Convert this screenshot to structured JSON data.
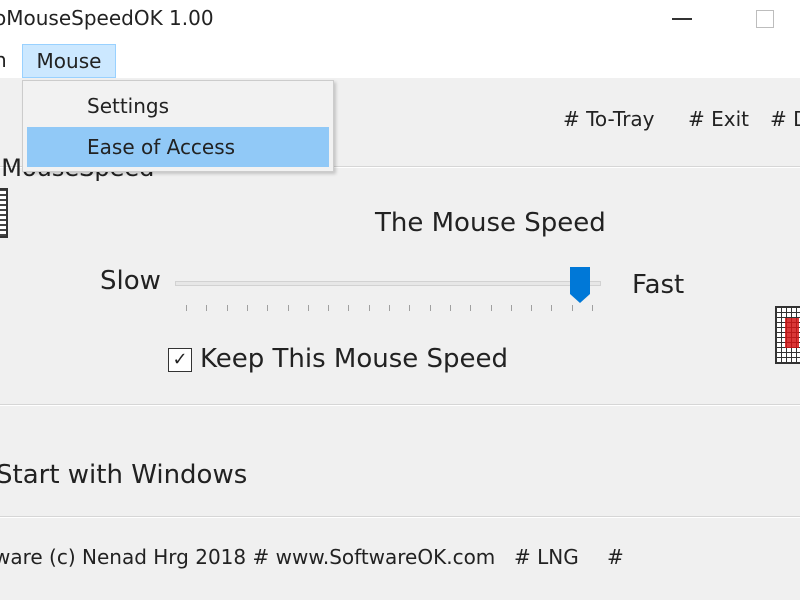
{
  "window": {
    "title": "oMouseSpeedOK 1.00"
  },
  "menubar": {
    "cut_item": "n",
    "mouse_menu": "Mouse"
  },
  "dropdown": {
    "items": [
      {
        "label": "Settings",
        "highlighted": false
      },
      {
        "label": "Ease of Access",
        "highlighted": true
      }
    ],
    "highlight_color": "#91c9f7"
  },
  "toolbar": {
    "to_tray": "# To-Tray",
    "exit": "# Exit",
    "cut": "# D"
  },
  "main": {
    "heading": "pMouseSpeed",
    "speed_title": "The Mouse Speed",
    "slow_label": "Slow",
    "fast_label": "Fast",
    "slider": {
      "value_fraction": 0.97,
      "thumb_color": "#0078d7",
      "tick_count": 21
    },
    "keep_speed": {
      "label": "Keep This Mouse Speed",
      "checked": true,
      "mark": "✓"
    },
    "start_with_windows": "Start with Windows"
  },
  "footer": {
    "copyright": "ware (c) Nenad Hrg 2018 # www.SoftwareOK.com",
    "lng": "# LNG",
    "hash": "#"
  },
  "icons": {
    "minimize": "minimize-icon",
    "maximize": "maximize-icon",
    "app_left": "app-icon",
    "app_right": "app-icon"
  }
}
